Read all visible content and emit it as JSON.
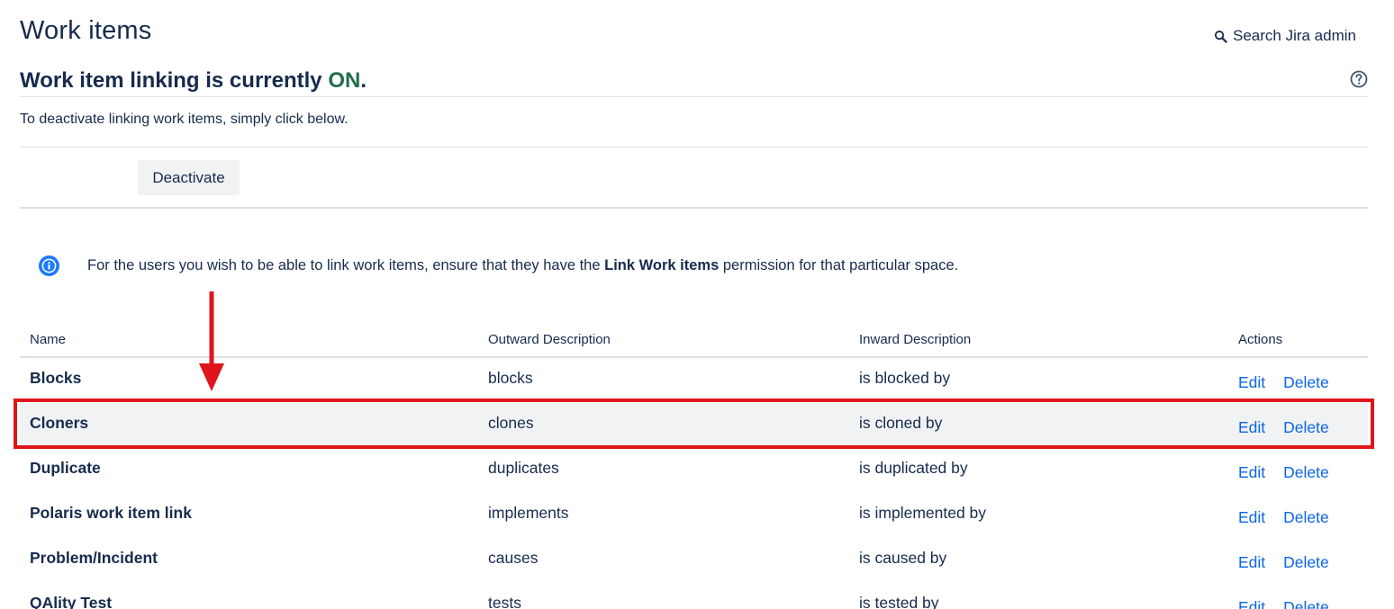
{
  "header": {
    "title": "Work items",
    "search_label": "Search Jira admin"
  },
  "status": {
    "heading_prefix": "Work item linking is currently ",
    "heading_state": "ON",
    "heading_suffix": ".",
    "description": "To deactivate linking work items, simply click below.",
    "deactivate_label": "Deactivate"
  },
  "info": {
    "text_before": "For the users you wish to be able to link work items, ensure that they have the ",
    "text_bold": "Link Work items",
    "text_after": " permission for that particular space."
  },
  "table": {
    "headers": {
      "name": "Name",
      "outward": "Outward Description",
      "inward": "Inward Description",
      "actions": "Actions"
    },
    "rows": [
      {
        "name": "Blocks",
        "outward": "blocks",
        "inward": "is blocked by",
        "edit": "Edit",
        "delete": "Delete"
      },
      {
        "name": "Cloners",
        "outward": "clones",
        "inward": "is cloned by",
        "edit": "Edit",
        "delete": "Delete"
      },
      {
        "name": "Duplicate",
        "outward": "duplicates",
        "inward": "is duplicated by",
        "edit": "Edit",
        "delete": "Delete"
      },
      {
        "name": "Polaris work item link",
        "outward": "implements",
        "inward": "is implemented by",
        "edit": "Edit",
        "delete": "Delete"
      },
      {
        "name": "Problem/Incident",
        "outward": "causes",
        "inward": "is caused by",
        "edit": "Edit",
        "delete": "Delete"
      },
      {
        "name": "QAlity Test",
        "outward": "tests",
        "inward": "is tested by",
        "edit": "Edit",
        "delete": "Delete"
      }
    ]
  },
  "icons": {
    "search": "search-icon",
    "help": "help-icon",
    "info": "info-icon"
  },
  "colors": {
    "status_on": "#216e4e",
    "link": "#0c66e4",
    "annotation": "#e0151b",
    "row_highlight": "#f1f2f4",
    "info_icon": "#1d7afc"
  }
}
